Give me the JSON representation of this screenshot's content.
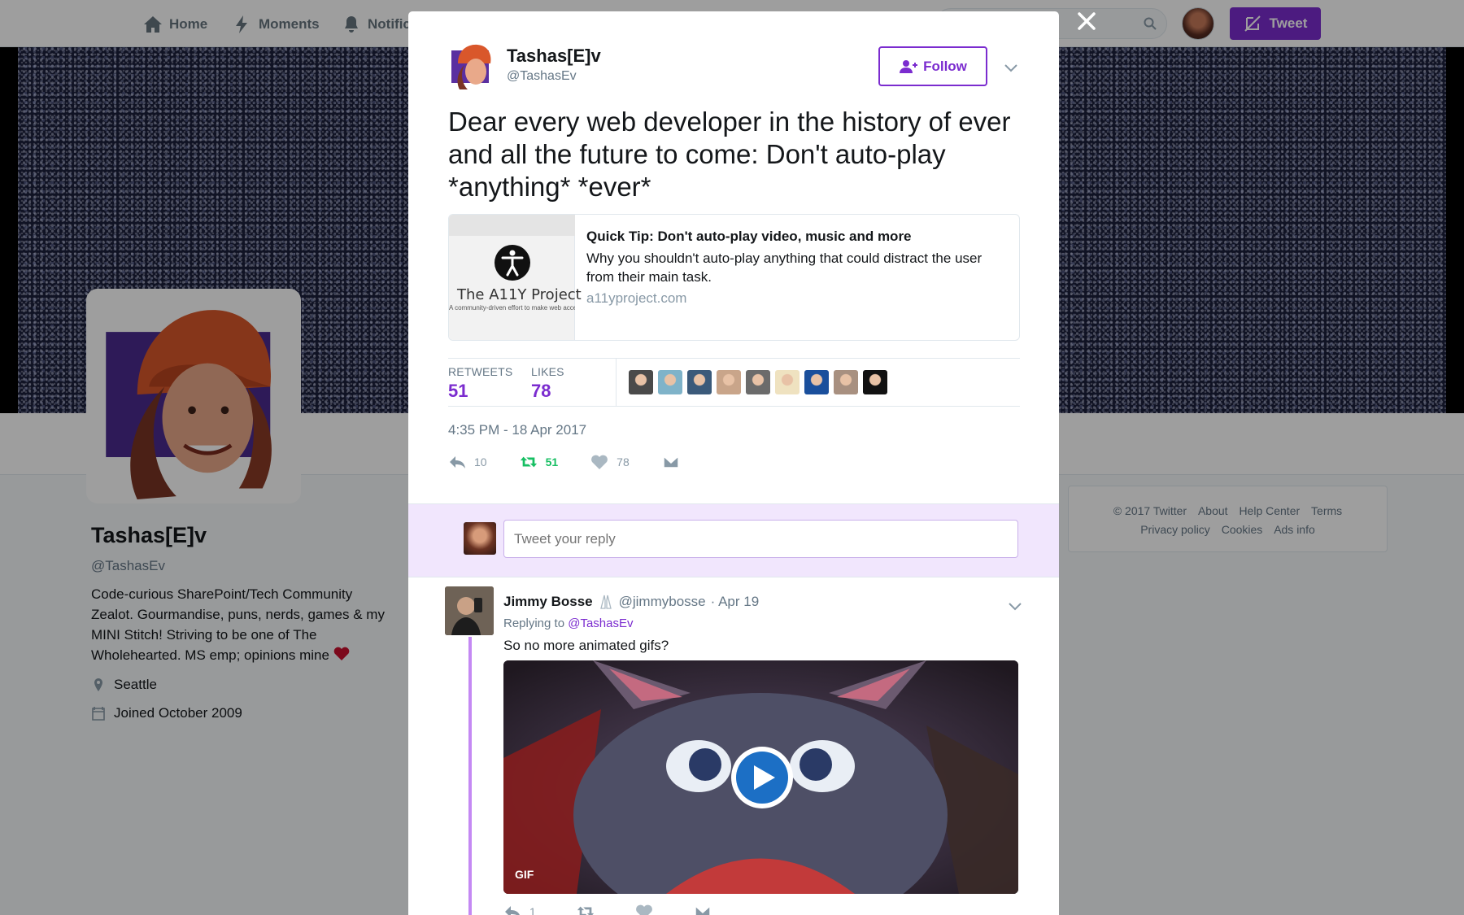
{
  "nav": {
    "home": "Home",
    "moments": "Moments",
    "notifications": "Notific",
    "tweet_button": "Tweet"
  },
  "profile": {
    "name": "Tashas[E]v",
    "handle": "@TashasEv",
    "bio": "Code-curious SharePoint/Tech Community Zealot. Gourmandise, puns, nerds, games & my MINI Stitch! Striving to be one of The Wholehearted. MS emp; opinions mine",
    "location": "Seattle",
    "joined": "Joined October 2009"
  },
  "footer": {
    "copyright": "© 2017 Twitter",
    "about": "About",
    "help": "Help Center",
    "terms": "Terms",
    "privacy": "Privacy policy",
    "cookies": "Cookies",
    "ads": "Ads info"
  },
  "tweet": {
    "author_name": "Tashas[E]v",
    "author_handle": "@TashasEv",
    "follow_label": "Follow",
    "text": "Dear every web developer in the history of ever and all the future to come: Don't auto-play *anything* *ever*",
    "card": {
      "image_title": "The A11Y Project",
      "image_subtitle": "A community-driven effort to make web accessibility easier",
      "title": "Quick Tip: Don't auto-play video, music and more",
      "description": "Why you shouldn't auto-play anything that could distract the user from their main task.",
      "url": "a11yproject.com"
    },
    "retweets_label": "RETWEETS",
    "retweets_value": "51",
    "likes_label": "LIKES",
    "likes_value": "78",
    "timestamp": "4:35 PM - 18 Apr 2017",
    "reply_count": "10",
    "retweet_count": "51",
    "like_count": "78"
  },
  "likers": [
    "#4a4a4a",
    "#7fb3c9",
    "#3b5a7a",
    "#c9a58a",
    "#6b6b6b",
    "#efe2c0",
    "#1a4f9c",
    "#a89080",
    "#111111"
  ],
  "reply_box": {
    "placeholder": "Tweet your reply"
  },
  "reply": {
    "name": "Jimmy Bosse",
    "handle": "@jimmybosse",
    "date": "· Apr 19",
    "replying_prefix": "Replying to",
    "replying_to": "@TashasEv",
    "text": "So no more animated gifs?",
    "gif_label": "GIF",
    "reply_count": "1"
  },
  "colors": {
    "accent": "#7b2ccf",
    "retweet_green": "#17bf63",
    "reply_bar_bg": "#f1e6fd"
  }
}
